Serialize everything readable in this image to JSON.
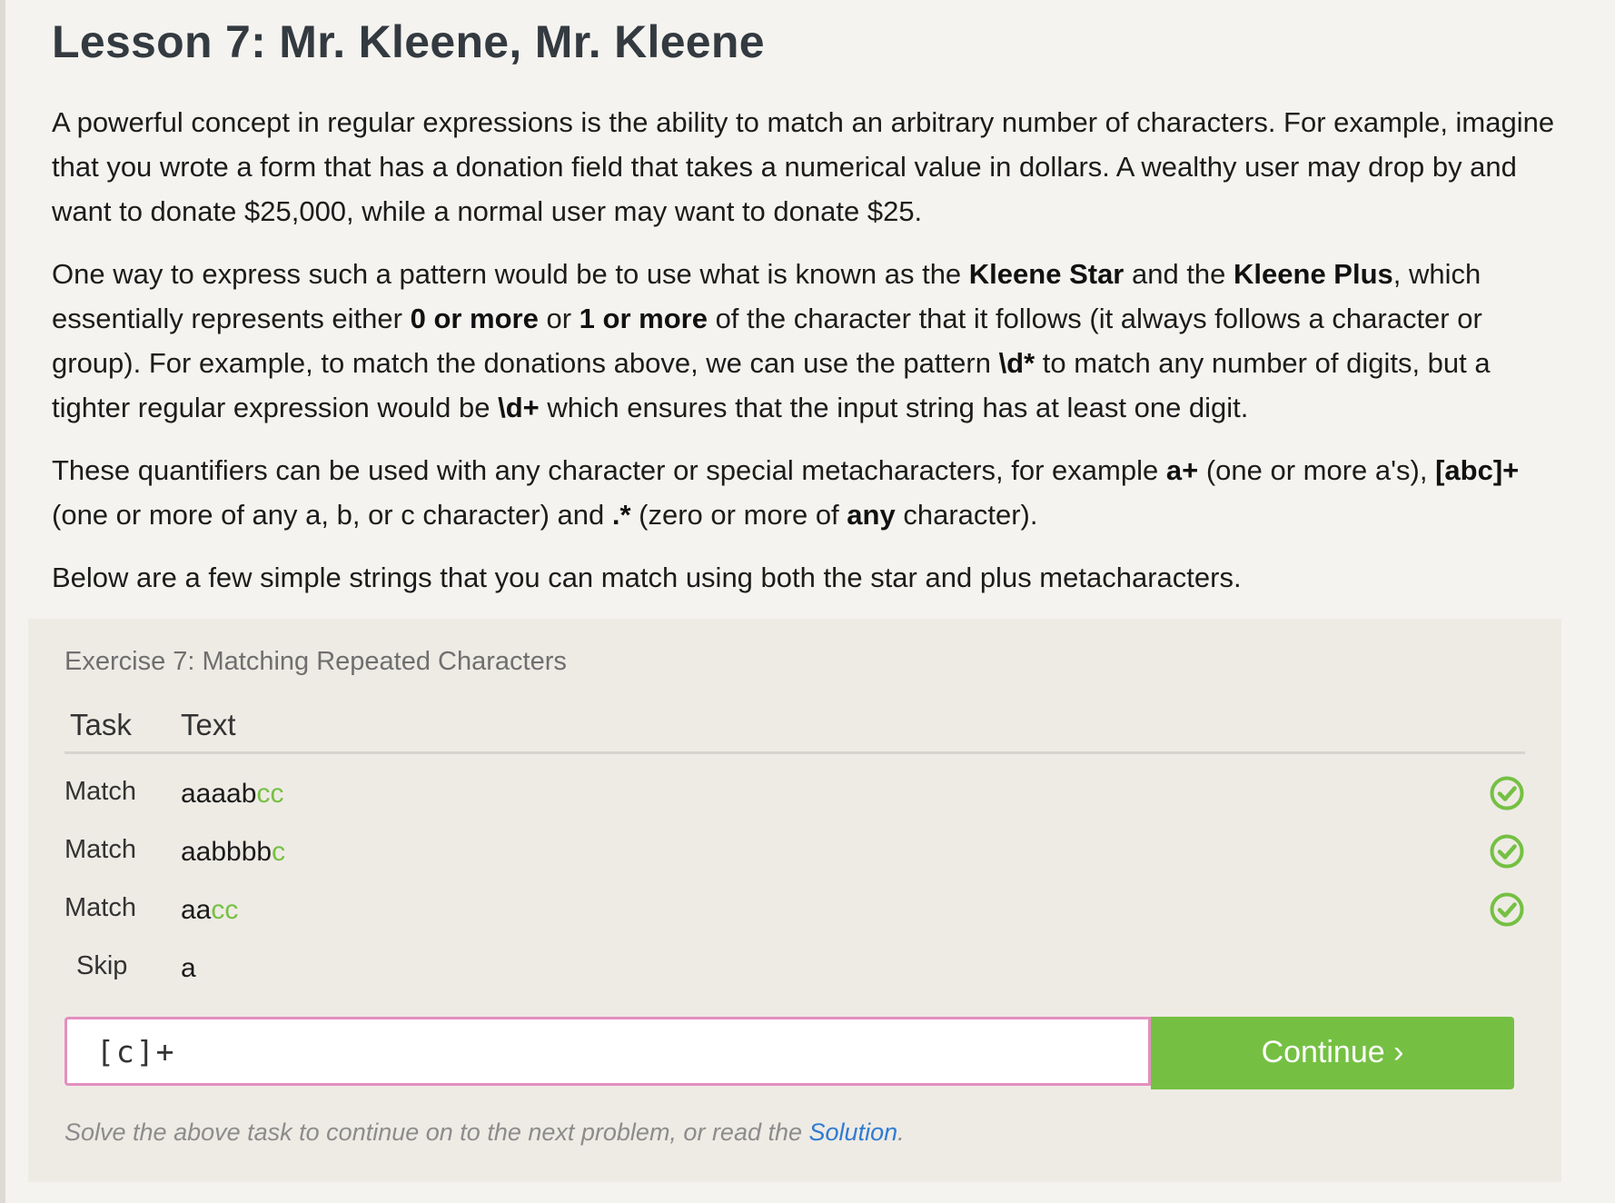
{
  "lesson": {
    "title": "Lesson 7: Mr. Kleene, Mr. Kleene",
    "p1": "A powerful concept in regular expressions is the ability to match an arbitrary number of characters. For example, imagine that you wrote a form that has a donation field that takes a numerical value in dollars. A wealthy user may drop by and want to donate $25,000, while a normal user may want to donate $25.",
    "p2": {
      "a": "One way to express such a pattern would be to use what is known as the ",
      "b1": "Kleene Star",
      "c": " and the ",
      "b2": "Kleene Plus",
      "d": ", which essentially represents either ",
      "b3": "0 or more",
      "e": " or ",
      "b4": "1 or more",
      "f": " of the character that it follows (it always follows a character or group). For example, to match the donations above, we can use the pattern ",
      "b5": "\\d*",
      "g": " to match any number of digits, but a tighter regular expression would be ",
      "b6": "\\d+",
      "h": " which ensures that the input string has at least one digit."
    },
    "p3": {
      "a": "These quantifiers can be used with any character or special metacharacters, for example ",
      "b1": "a+",
      "c": " (one or more a's), ",
      "b2": "[abc]+",
      "d": " (one or more of any a, b, or c character) and ",
      "b3": ".*",
      "e": " (zero or more of ",
      "b4": "any",
      "f": " character)."
    },
    "p4": "Below are a few simple strings that you can match using both the star and plus metacharacters."
  },
  "exercise": {
    "title": "Exercise 7: Matching Repeated Characters",
    "header_task": "Task",
    "header_text": "Text",
    "rows": [
      {
        "task": "Match",
        "text_plain": "aaaab",
        "text_hl": "cc",
        "status": "check-icon"
      },
      {
        "task": "Match",
        "text_plain": "aabbbb",
        "text_hl": "c",
        "status": "check-icon"
      },
      {
        "task": "Match",
        "text_plain": "aa",
        "text_hl": "cc",
        "status": "check-icon"
      },
      {
        "task": "Skip",
        "text_plain": "a",
        "text_hl": ""
      }
    ],
    "input_value": "[c]+",
    "continue_label": "Continue ›",
    "hint_prefix": "Solve the above task to continue on to the next problem, or read the ",
    "hint_link": "Solution",
    "hint_suffix": "."
  },
  "colors": {
    "accent_green": "#75c043",
    "highlight_green": "#76c043",
    "input_border": "#e48fc0",
    "link_blue": "#2f7bd2"
  }
}
